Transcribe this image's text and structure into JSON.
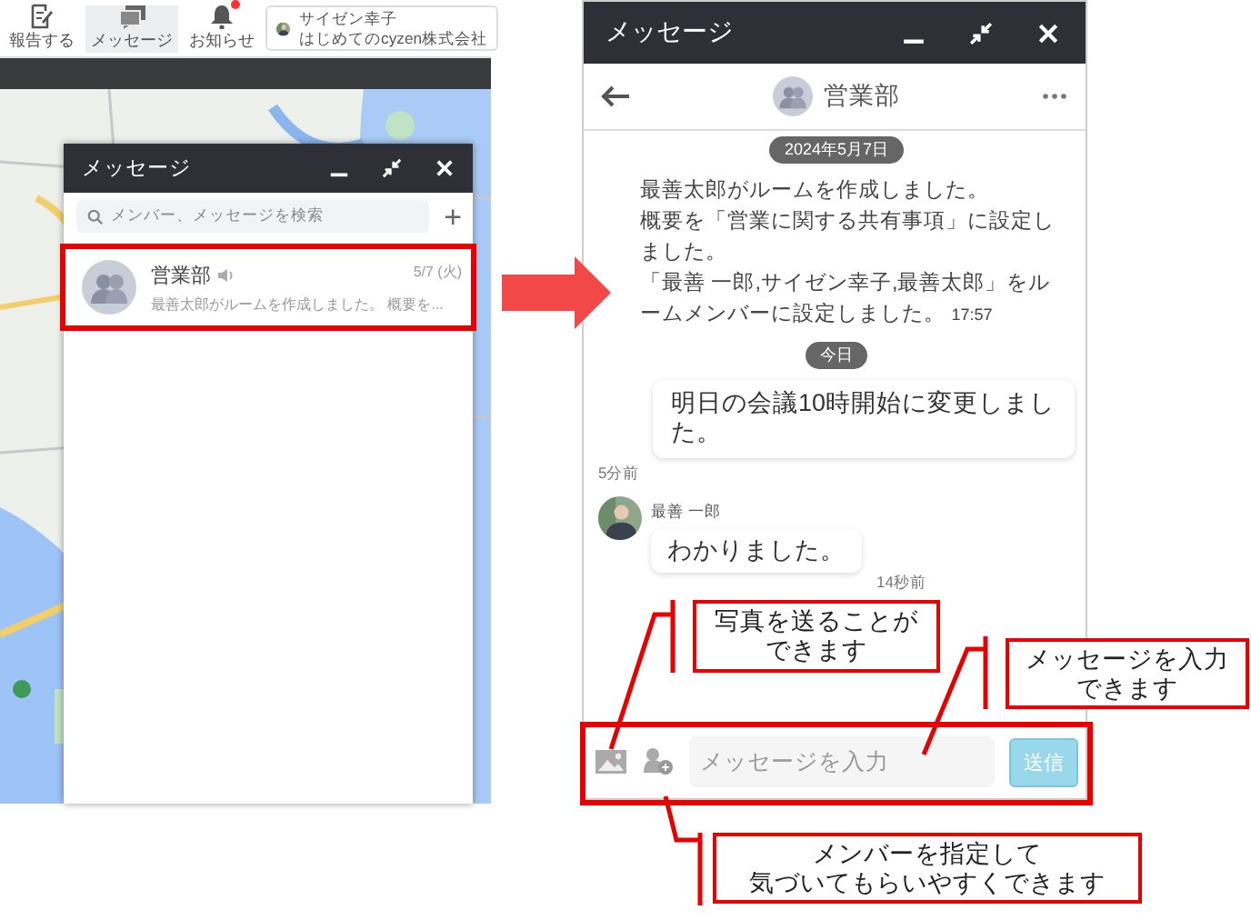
{
  "left_app": {
    "nav": [
      {
        "label": "報告する",
        "selected": false,
        "badge": false
      },
      {
        "label": "メッセージ",
        "selected": true,
        "badge": false
      },
      {
        "label": "お知らせ",
        "selected": false,
        "badge": true
      }
    ],
    "profile": {
      "name": "サイゼン幸子",
      "company": "はじめてのcyzen株式会社"
    },
    "message_window": {
      "title": "メッセージ",
      "search_placeholder": "メンバー、メッセージを検索",
      "add_button": "+",
      "rooms": [
        {
          "name": "営業部",
          "date": "5/7 (火)",
          "preview": "最善太郎がルームを作成しました。 概要を...",
          "muted": true
        }
      ]
    }
  },
  "right_app": {
    "title": "メッセージ",
    "room_name": "営業部",
    "messages": [
      {
        "kind": "date",
        "text": "2024年5月7日"
      },
      {
        "kind": "system",
        "lines": [
          "最善太郎がルームを作成しました。",
          "概要を「営業に関する共有事項」に設定しました。",
          "「最善 一郎,サイゼン幸子,最善太郎」をルームメンバーに設定しました。"
        ],
        "time": "17:57"
      },
      {
        "kind": "date",
        "text": "今日"
      },
      {
        "kind": "own",
        "text": "明日の会議10時開始に変更しました。",
        "time": "5分前"
      },
      {
        "kind": "other",
        "sender": "最善 一郎",
        "text": "わかりました。",
        "time": "14秒前"
      }
    ],
    "composer": {
      "placeholder": "メッセージを入力",
      "send": "送信"
    }
  },
  "callouts": [
    {
      "lines": [
        "写真を送ることが",
        "できます"
      ]
    },
    {
      "lines": [
        "メッセージを入力",
        "できます"
      ]
    },
    {
      "lines": [
        "メンバーを指定して",
        "気づいてもらいやすくできます"
      ]
    }
  ]
}
